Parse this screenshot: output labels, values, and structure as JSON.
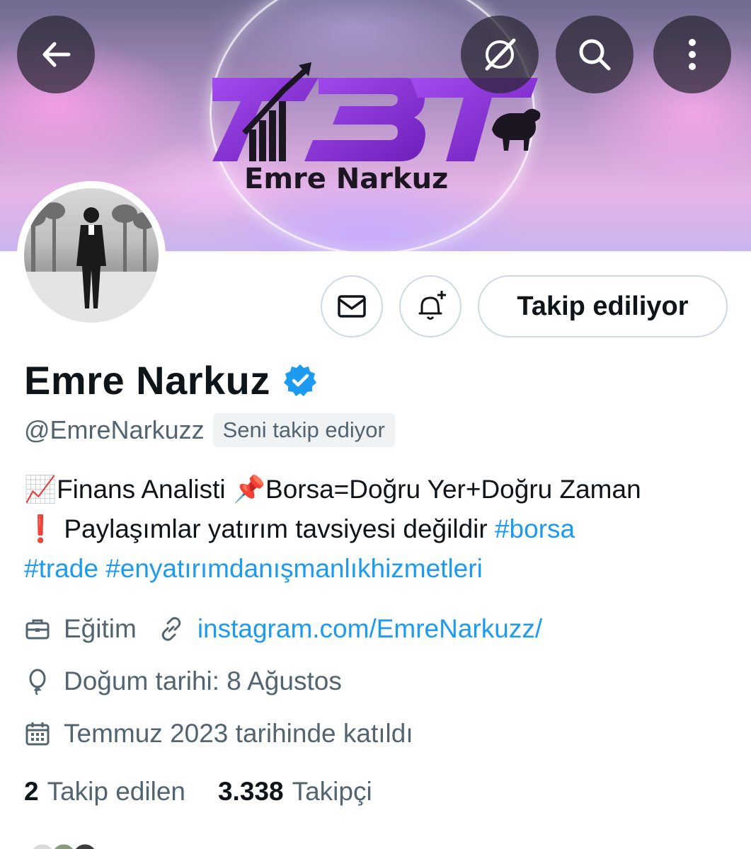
{
  "banner": {
    "logo_letters": "ZBT",
    "logo_name": "Emre Narkuz",
    "colors": {
      "purple": "#8b2fd6",
      "dark": "#1b1622"
    }
  },
  "top_bar": {
    "back_icon": "arrow-left-icon",
    "grok_icon": "slash-circle-icon",
    "search_icon": "search-icon",
    "more_icon": "more-vertical-icon"
  },
  "actions": {
    "message_icon": "envelope-icon",
    "notify_icon": "bell-plus-icon",
    "follow_label": "Takip ediliyor"
  },
  "profile": {
    "name": "Emre Narkuz",
    "handle": "@EmreNarkuzz",
    "follows_you": "Seni takip ediyor",
    "bio": {
      "line1_emoji": "📈",
      "line1_a": "Finans Analisti ",
      "line1_pin": "📌",
      "line1_b": "Borsa=Doğru Yer+Doğru Zaman",
      "line2_emoji": "❗",
      "line2_text": " Paylaşımlar yatırım tavsiyesi değildir ",
      "tag1": "#borsa",
      "tag2": "#trade",
      "tag3": "#enyatırımdanışmanlıkhizmetleri"
    },
    "category": "Eğitim",
    "link": "instagram.com/EmreNarkuzz/",
    "birthday": "Doğum tarihi: 8 Ağustos",
    "joined": "Temmuz 2023 tarihinde katıldı"
  },
  "stats": {
    "following_count": "2",
    "following_label": "Takip edilen",
    "followers_count": "3.338",
    "followers_label": "Takipçi"
  },
  "colors": {
    "accent": "#1d9bf0",
    "secondary_text": "#536471",
    "primary_text": "#0f1419"
  }
}
